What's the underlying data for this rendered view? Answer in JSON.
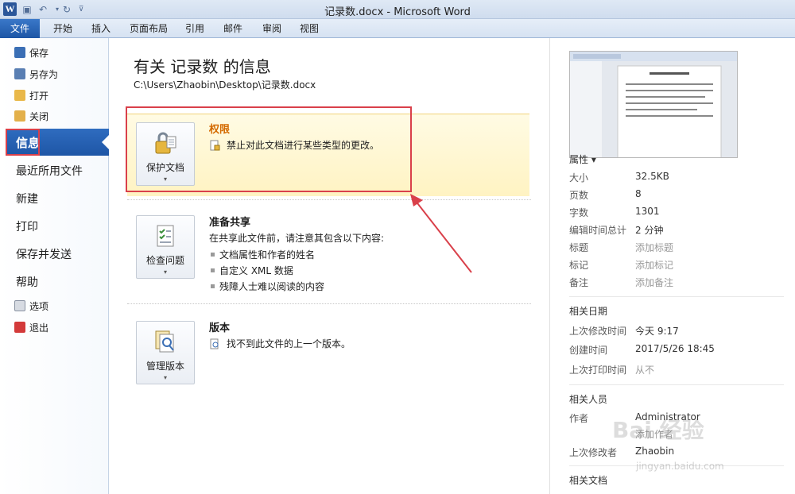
{
  "window": {
    "title": "记录数.docx - Microsoft Word"
  },
  "ribbon": {
    "file_tab": "文件",
    "tabs": [
      "开始",
      "插入",
      "页面布局",
      "引用",
      "邮件",
      "审阅",
      "视图"
    ]
  },
  "nav": {
    "small_top": [
      {
        "label": "保存",
        "icon": "save-icon"
      },
      {
        "label": "另存为",
        "icon": "save-as-icon"
      },
      {
        "label": "打开",
        "icon": "open-folder-icon"
      },
      {
        "label": "关闭",
        "icon": "close-folder-icon"
      }
    ],
    "active": "信息",
    "big": [
      "最近所用文件",
      "新建",
      "打印",
      "保存并发送",
      "帮助"
    ],
    "small_bottom": [
      {
        "label": "选项",
        "icon": "options-icon"
      },
      {
        "label": "退出",
        "icon": "exit-icon"
      }
    ]
  },
  "main": {
    "title": "有关 记录数 的信息",
    "path": "C:\\Users\\Zhaobin\\Desktop\\记录数.docx",
    "sections": [
      {
        "button": "保护文档",
        "title": "权限",
        "title_color": "#d46a00",
        "lines": [
          "禁止对此文档进行某些类型的更改。"
        ]
      },
      {
        "button": "检查问题",
        "title": "准备共享",
        "title_color": "#1e1e1e",
        "intro": "在共享此文件前，请注意其包含以下内容:",
        "bullets": [
          "文档属性和作者的姓名",
          "自定义 XML 数据",
          "残障人士难以阅读的内容"
        ]
      },
      {
        "button": "管理版本",
        "title": "版本",
        "title_color": "#1e1e1e",
        "lines": [
          "找不到此文件的上一个版本。"
        ]
      }
    ]
  },
  "properties": {
    "header": "属性 ▾",
    "rows": [
      {
        "k": "大小",
        "v": "32.5KB"
      },
      {
        "k": "页数",
        "v": "8"
      },
      {
        "k": "字数",
        "v": "1301"
      },
      {
        "k": "编辑时间总计",
        "v": "2 分钟"
      },
      {
        "k": "标题",
        "v": "添加标题",
        "muted": true
      },
      {
        "k": "标记",
        "v": "添加标记",
        "muted": true
      },
      {
        "k": "备注",
        "v": "添加备注",
        "muted": true
      }
    ],
    "dates_header": "相关日期",
    "dates": [
      {
        "k": "上次修改时间",
        "v": "今天 9:17"
      },
      {
        "k": "创建时间",
        "v": "2017/5/26 18:45"
      },
      {
        "k": "上次打印时间",
        "v": "从不"
      }
    ],
    "people_header": "相关人员",
    "people": [
      {
        "k": "作者",
        "v": "Administrator"
      },
      {
        "k": "",
        "v": "添加作者",
        "muted": true
      },
      {
        "k": "上次修改者",
        "v": "Zhaobin"
      }
    ],
    "docs_header": "相关文档"
  },
  "watermark": {
    "line1": "Bai 经验",
    "line2": "jingyan.baidu.com"
  },
  "colors": {
    "accent": "#1e56a6",
    "highlight_red": "#d9404a"
  }
}
